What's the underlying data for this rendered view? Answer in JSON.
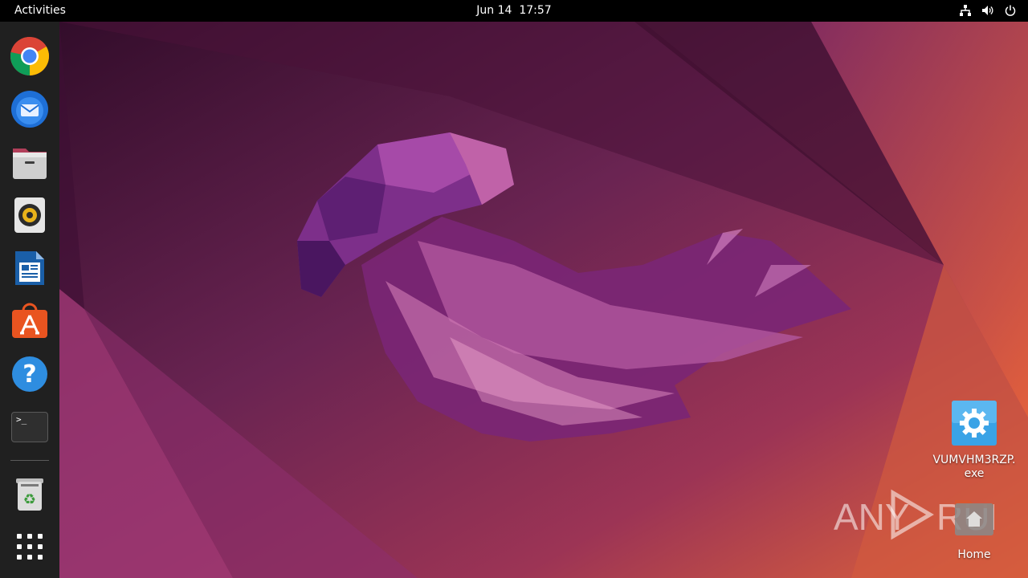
{
  "topbar": {
    "activities_label": "Activities",
    "date": "Jun 14",
    "time": "17:57",
    "tray_icons": [
      "network-icon",
      "volume-icon",
      "power-icon"
    ]
  },
  "dock": {
    "items": [
      {
        "name": "chrome-icon",
        "app": "Google Chrome"
      },
      {
        "name": "thunderbird-icon",
        "app": "Thunderbird"
      },
      {
        "name": "files-icon",
        "app": "Files"
      },
      {
        "name": "rhythmbox-icon",
        "app": "Rhythmbox"
      },
      {
        "name": "libreoffice-writer-icon",
        "app": "LibreOffice Writer"
      },
      {
        "name": "app-center-icon",
        "app": "Ubuntu Software"
      },
      {
        "name": "help-icon",
        "app": "Help"
      },
      {
        "name": "terminal-icon",
        "app": "Terminal"
      },
      {
        "name": "trash-icon",
        "app": "Trash"
      },
      {
        "name": "show-apps-icon",
        "app": "Show Applications"
      }
    ],
    "terminal_prompt": ">_"
  },
  "desktop": {
    "icons": [
      {
        "label": "VUMVHM3RZP.\nexe",
        "icon": "settings-gear-icon"
      },
      {
        "label": "Home",
        "icon": "home-folder-icon"
      }
    ]
  },
  "watermark": {
    "text_left": "ANY",
    "text_right": "RUN"
  },
  "colors": {
    "topbar": "#000000",
    "dock": "#202020",
    "wallpaper_dark": "#2c0a26",
    "wallpaper_mid": "#7a2a5e",
    "wallpaper_orange": "#d9573a",
    "exe_icon_blue": "#3aa3e6"
  }
}
